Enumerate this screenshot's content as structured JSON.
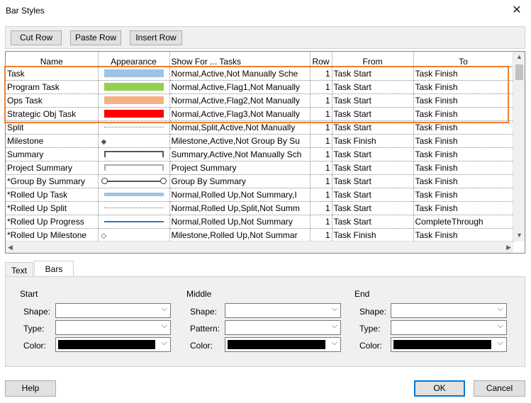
{
  "window": {
    "title": "Bar Styles",
    "close_label": "✕"
  },
  "toolbar": {
    "cut_row": "Cut Row",
    "paste_row": "Paste Row",
    "insert_row": "Insert Row"
  },
  "columns": {
    "name": "Name",
    "appearance": "Appearance",
    "show_for": "Show For ... Tasks",
    "row": "Row",
    "from": "From",
    "to": "To"
  },
  "rows": [
    {
      "name": "Task",
      "appearance": "bar-light-blue",
      "show_for": "Normal,Active,Not Manually Sche",
      "row": "1",
      "from": "Task Start",
      "to": "Task Finish"
    },
    {
      "name": "Program Task",
      "appearance": "bar-green",
      "show_for": "Normal,Active,Flag1,Not Manually",
      "row": "1",
      "from": "Task Start",
      "to": "Task Finish"
    },
    {
      "name": "Ops Task",
      "appearance": "bar-peach",
      "show_for": "Normal,Active,Flag2,Not Manually",
      "row": "1",
      "from": "Task Start",
      "to": "Task Finish"
    },
    {
      "name": "Strategic Obj Task",
      "appearance": "bar-red",
      "show_for": "Normal,Active,Flag3,Not Manually",
      "row": "1",
      "from": "Task Start",
      "to": "Task Finish"
    },
    {
      "name": "Split",
      "appearance": "dotted-line",
      "show_for": "Normal,Split,Active,Not Manually",
      "row": "1",
      "from": "Task Start",
      "to": "Task Finish"
    },
    {
      "name": "Milestone",
      "appearance": "diamond",
      "show_for": "Milestone,Active,Not Group By Su",
      "row": "1",
      "from": "Task Finish",
      "to": "Task Finish"
    },
    {
      "name": "Summary",
      "appearance": "summary-bracket",
      "show_for": "Summary,Active,Not Manually Sch",
      "row": "1",
      "from": "Task Start",
      "to": "Task Finish"
    },
    {
      "name": "Project Summary",
      "appearance": "project-summary-bracket",
      "show_for": "Project Summary",
      "row": "1",
      "from": "Task Start",
      "to": "Task Finish"
    },
    {
      "name": "*Group By Summary",
      "appearance": "group-line-circles",
      "show_for": "Group By Summary",
      "row": "1",
      "from": "Task Start",
      "to": "Task Finish"
    },
    {
      "name": "*Rolled Up Task",
      "appearance": "bar-thin-blue",
      "show_for": "Normal,Rolled Up,Not Summary,I",
      "row": "1",
      "from": "Task Start",
      "to": "Task Finish"
    },
    {
      "name": "*Rolled Up Split",
      "appearance": "dotted-line",
      "show_for": "Normal,Rolled Up,Split,Not Summ",
      "row": "1",
      "from": "Task Start",
      "to": "Task Finish"
    },
    {
      "name": "*Rolled Up Progress",
      "appearance": "line-blue",
      "show_for": "Normal,Rolled Up,Not Summary",
      "row": "1",
      "from": "Task Start",
      "to": "CompleteThrough"
    },
    {
      "name": "*Rolled Up Milestone",
      "appearance": "diamond-outline",
      "show_for": "Milestone,Rolled Up,Not Summar",
      "row": "1",
      "from": "Task Finish",
      "to": "Task Finish"
    }
  ],
  "colors": {
    "light_blue": "#9dc3e6",
    "green": "#92d050",
    "peach": "#f4b183",
    "red": "#ff0000",
    "highlight_border": "#ed7d31",
    "dark_blue": "#2e75b6"
  },
  "tabs": {
    "text": "Text",
    "bars": "Bars",
    "selected": "Bars"
  },
  "groups": {
    "start": {
      "title": "Start",
      "shape_label": "Shape:",
      "type_label": "Type:",
      "color_label": "Color:"
    },
    "middle": {
      "title": "Middle",
      "shape_label": "Shape:",
      "pattern_label": "Pattern:",
      "color_label": "Color:"
    },
    "end": {
      "title": "End",
      "shape_label": "Shape:",
      "type_label": "Type:",
      "color_label": "Color:"
    }
  },
  "footer": {
    "help": "Help",
    "ok": "OK",
    "cancel": "Cancel"
  }
}
